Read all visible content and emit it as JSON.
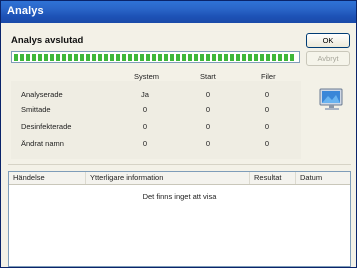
{
  "window": {
    "title": "Analys"
  },
  "status": "Analys avslutad",
  "progress": {
    "percent": 100,
    "color": "#3fb73a"
  },
  "buttons": {
    "ok": "OK",
    "cancel": "Avbryt"
  },
  "stats": {
    "headers": [
      "System",
      "Start",
      "Filer"
    ],
    "rows": [
      {
        "label": "Analyserade",
        "values": [
          "Ja",
          "0",
          "0"
        ]
      },
      {
        "label": "Smittade",
        "values": [
          "0",
          "0",
          "0"
        ]
      },
      {
        "label": "Desinfekterade",
        "values": [
          "0",
          "0",
          "0"
        ]
      },
      {
        "label": "Ändrat namn",
        "values": [
          "0",
          "0",
          "0"
        ]
      }
    ]
  },
  "list": {
    "columns": [
      "Händelse",
      "Ytterligare information",
      "Resultat",
      "Datum"
    ],
    "empty_text": "Det finns inget att visa"
  },
  "icons": {
    "computer": "computer-monitor-icon"
  }
}
